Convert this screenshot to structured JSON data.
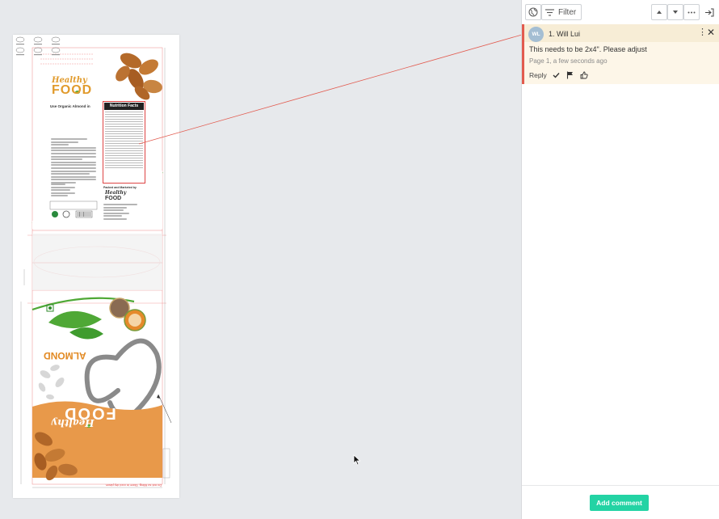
{
  "toolbar": {
    "filter_label": "Filter",
    "icons": [
      "globe-icon",
      "filter-icon",
      "arrow-up-icon",
      "arrow-down-icon",
      "more-icon",
      "exit-panel-icon"
    ]
  },
  "comment": {
    "avatar_initials": "WL",
    "avatar_color": "#a4bed3",
    "author": "1. Will Lui",
    "text": "This needs to be 2x4\". Please adjust",
    "meta": "Page 1, a few seconds ago",
    "reply_label": "Reply",
    "accent_color": "#e25b4f",
    "highlight_color": "#fdf6e8"
  },
  "footer": {
    "add_comment_label": "Add comment",
    "button_color": "#23d3a4"
  },
  "artwork": {
    "brand_script": "Healthy",
    "brand_word": "FOOD",
    "organic_title": "Use Organic Almond in",
    "nutrition_title": "Nutrition Facts",
    "packed_by": "Packed and Marketed by",
    "product_word": "ALMOND",
    "footer_note": "Do not so filling. Store in cool dry place."
  }
}
